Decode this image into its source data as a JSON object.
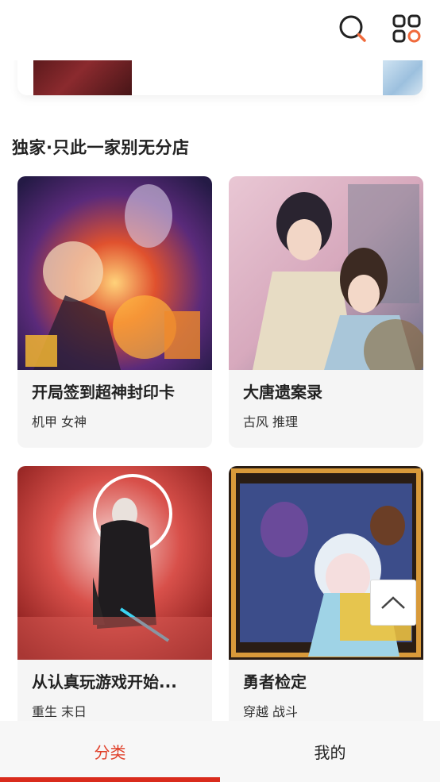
{
  "header": {
    "search_icon": "search-icon",
    "menu_icon": "grid-menu-icon",
    "accent_color": "#f06a3c"
  },
  "section": {
    "title": "独家·只此一家别无分店"
  },
  "comics": [
    {
      "title": "开局签到超神封印卡",
      "tags": [
        "机甲",
        "女神"
      ]
    },
    {
      "title": "大唐遗案录",
      "tags": [
        "古风",
        "推理"
      ]
    },
    {
      "title": "从认真玩游戏开始...",
      "tags": [
        "重生",
        "末日"
      ]
    },
    {
      "title": "勇者检定",
      "tags": [
        "穿越",
        "战斗"
      ]
    }
  ],
  "back_to_top": {
    "icon": "chevron-up-icon"
  },
  "bottom_nav": {
    "tabs": [
      {
        "label": "分类",
        "active": true
      },
      {
        "label": "我的",
        "active": false
      }
    ],
    "active_color": "#d92b1c"
  }
}
